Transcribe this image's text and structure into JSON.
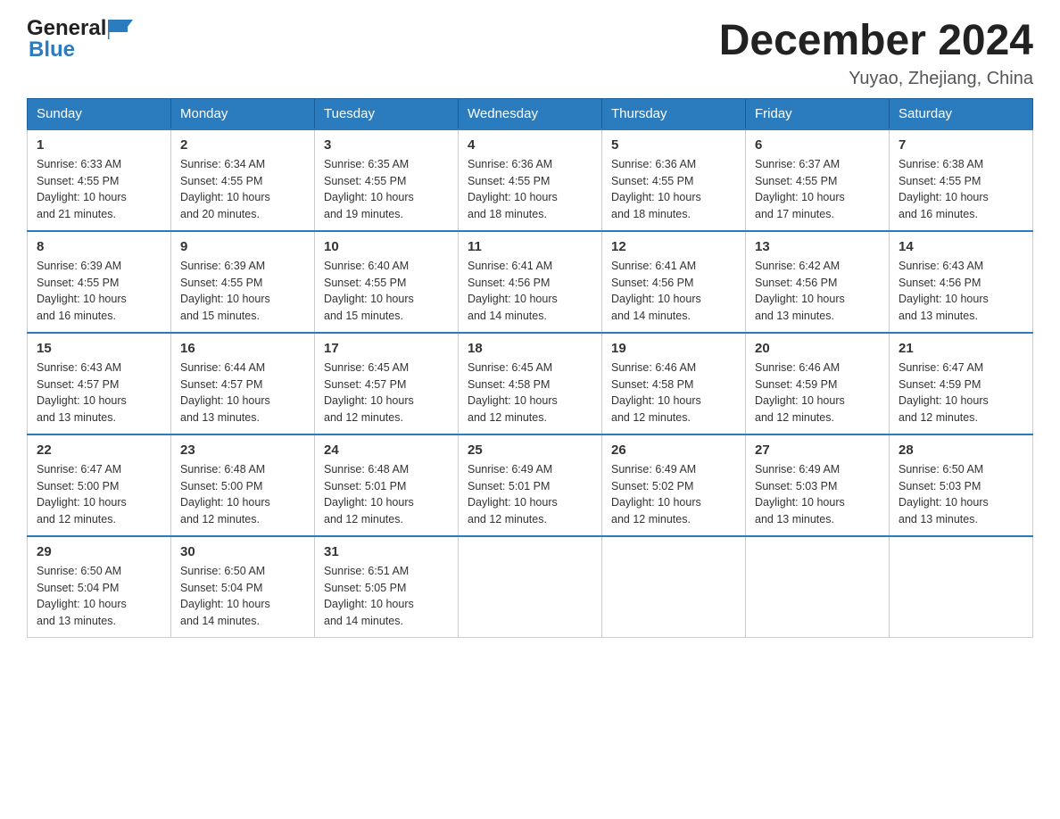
{
  "header": {
    "logo_general": "General",
    "logo_blue": "Blue",
    "title": "December 2024",
    "location": "Yuyao, Zhejiang, China"
  },
  "days_of_week": [
    "Sunday",
    "Monday",
    "Tuesday",
    "Wednesday",
    "Thursday",
    "Friday",
    "Saturday"
  ],
  "weeks": [
    [
      {
        "day": "1",
        "sunrise": "6:33 AM",
        "sunset": "4:55 PM",
        "daylight": "10 hours and 21 minutes."
      },
      {
        "day": "2",
        "sunrise": "6:34 AM",
        "sunset": "4:55 PM",
        "daylight": "10 hours and 20 minutes."
      },
      {
        "day": "3",
        "sunrise": "6:35 AM",
        "sunset": "4:55 PM",
        "daylight": "10 hours and 19 minutes."
      },
      {
        "day": "4",
        "sunrise": "6:36 AM",
        "sunset": "4:55 PM",
        "daylight": "10 hours and 18 minutes."
      },
      {
        "day": "5",
        "sunrise": "6:36 AM",
        "sunset": "4:55 PM",
        "daylight": "10 hours and 18 minutes."
      },
      {
        "day": "6",
        "sunrise": "6:37 AM",
        "sunset": "4:55 PM",
        "daylight": "10 hours and 17 minutes."
      },
      {
        "day": "7",
        "sunrise": "6:38 AM",
        "sunset": "4:55 PM",
        "daylight": "10 hours and 16 minutes."
      }
    ],
    [
      {
        "day": "8",
        "sunrise": "6:39 AM",
        "sunset": "4:55 PM",
        "daylight": "10 hours and 16 minutes."
      },
      {
        "day": "9",
        "sunrise": "6:39 AM",
        "sunset": "4:55 PM",
        "daylight": "10 hours and 15 minutes."
      },
      {
        "day": "10",
        "sunrise": "6:40 AM",
        "sunset": "4:55 PM",
        "daylight": "10 hours and 15 minutes."
      },
      {
        "day": "11",
        "sunrise": "6:41 AM",
        "sunset": "4:56 PM",
        "daylight": "10 hours and 14 minutes."
      },
      {
        "day": "12",
        "sunrise": "6:41 AM",
        "sunset": "4:56 PM",
        "daylight": "10 hours and 14 minutes."
      },
      {
        "day": "13",
        "sunrise": "6:42 AM",
        "sunset": "4:56 PM",
        "daylight": "10 hours and 13 minutes."
      },
      {
        "day": "14",
        "sunrise": "6:43 AM",
        "sunset": "4:56 PM",
        "daylight": "10 hours and 13 minutes."
      }
    ],
    [
      {
        "day": "15",
        "sunrise": "6:43 AM",
        "sunset": "4:57 PM",
        "daylight": "10 hours and 13 minutes."
      },
      {
        "day": "16",
        "sunrise": "6:44 AM",
        "sunset": "4:57 PM",
        "daylight": "10 hours and 13 minutes."
      },
      {
        "day": "17",
        "sunrise": "6:45 AM",
        "sunset": "4:57 PM",
        "daylight": "10 hours and 12 minutes."
      },
      {
        "day": "18",
        "sunrise": "6:45 AM",
        "sunset": "4:58 PM",
        "daylight": "10 hours and 12 minutes."
      },
      {
        "day": "19",
        "sunrise": "6:46 AM",
        "sunset": "4:58 PM",
        "daylight": "10 hours and 12 minutes."
      },
      {
        "day": "20",
        "sunrise": "6:46 AM",
        "sunset": "4:59 PM",
        "daylight": "10 hours and 12 minutes."
      },
      {
        "day": "21",
        "sunrise": "6:47 AM",
        "sunset": "4:59 PM",
        "daylight": "10 hours and 12 minutes."
      }
    ],
    [
      {
        "day": "22",
        "sunrise": "6:47 AM",
        "sunset": "5:00 PM",
        "daylight": "10 hours and 12 minutes."
      },
      {
        "day": "23",
        "sunrise": "6:48 AM",
        "sunset": "5:00 PM",
        "daylight": "10 hours and 12 minutes."
      },
      {
        "day": "24",
        "sunrise": "6:48 AM",
        "sunset": "5:01 PM",
        "daylight": "10 hours and 12 minutes."
      },
      {
        "day": "25",
        "sunrise": "6:49 AM",
        "sunset": "5:01 PM",
        "daylight": "10 hours and 12 minutes."
      },
      {
        "day": "26",
        "sunrise": "6:49 AM",
        "sunset": "5:02 PM",
        "daylight": "10 hours and 12 minutes."
      },
      {
        "day": "27",
        "sunrise": "6:49 AM",
        "sunset": "5:03 PM",
        "daylight": "10 hours and 13 minutes."
      },
      {
        "day": "28",
        "sunrise": "6:50 AM",
        "sunset": "5:03 PM",
        "daylight": "10 hours and 13 minutes."
      }
    ],
    [
      {
        "day": "29",
        "sunrise": "6:50 AM",
        "sunset": "5:04 PM",
        "daylight": "10 hours and 13 minutes."
      },
      {
        "day": "30",
        "sunrise": "6:50 AM",
        "sunset": "5:04 PM",
        "daylight": "10 hours and 14 minutes."
      },
      {
        "day": "31",
        "sunrise": "6:51 AM",
        "sunset": "5:05 PM",
        "daylight": "10 hours and 14 minutes."
      },
      null,
      null,
      null,
      null
    ]
  ],
  "labels": {
    "sunrise": "Sunrise:",
    "sunset": "Sunset:",
    "daylight": "Daylight:"
  }
}
